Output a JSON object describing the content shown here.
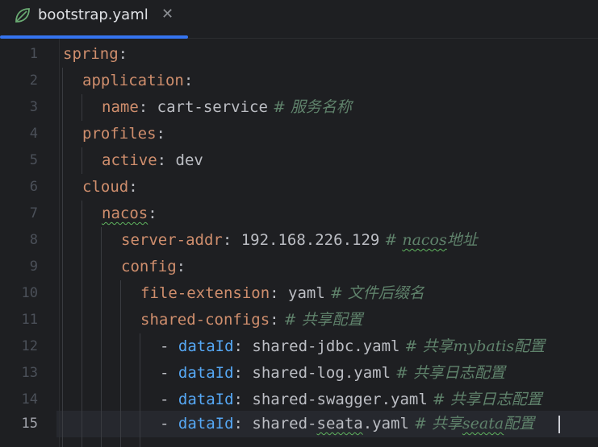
{
  "tab": {
    "filename": "bootstrap.yaml",
    "close_glyph": "✕",
    "icon": "spring-leaf-icon"
  },
  "colors": {
    "background": "#1e1f22",
    "key": "#cf8e6d",
    "blue_key": "#56a8f5",
    "comment": "#5f826b",
    "text": "#bcbec4",
    "accent": "#3574f0"
  },
  "lines": [
    {
      "num": "1",
      "key": "spring",
      "colon": ":",
      "value": "",
      "comment": ""
    },
    {
      "num": "2",
      "key": "application",
      "colon": ":",
      "value": "",
      "comment": ""
    },
    {
      "num": "3",
      "key": "name",
      "colon": ":",
      "value": " cart-service",
      "comment": " # 服务名称"
    },
    {
      "num": "4",
      "key": "profiles",
      "colon": ":",
      "value": "",
      "comment": ""
    },
    {
      "num": "5",
      "key": "active",
      "colon": ":",
      "value": " dev",
      "comment": ""
    },
    {
      "num": "6",
      "key": "cloud",
      "colon": ":",
      "value": "",
      "comment": ""
    },
    {
      "num": "7",
      "key": "nacos",
      "colon": ":",
      "value": "",
      "comment": ""
    },
    {
      "num": "8",
      "key": "server-addr",
      "colon": ":",
      "value": " 192.168.226.129",
      "comment_hash": " # ",
      "comment_word": "nacos",
      "comment_tail": "地址"
    },
    {
      "num": "9",
      "key": "config",
      "colon": ":",
      "value": "",
      "comment": ""
    },
    {
      "num": "10",
      "key": "file-extension",
      "colon": ":",
      "value": " yaml",
      "comment": " # 文件后缀名"
    },
    {
      "num": "11",
      "key": "shared-configs",
      "colon": ":",
      "value": "",
      "comment": " # 共享配置"
    },
    {
      "num": "12",
      "dash": "- ",
      "key": "dataId",
      "colon": ":",
      "value": " shared-jdbc.yaml",
      "comment": " # 共享mybatis配置"
    },
    {
      "num": "13",
      "dash": "- ",
      "key": "dataId",
      "colon": ":",
      "value": " shared-log.yaml",
      "comment": " # 共享日志配置"
    },
    {
      "num": "14",
      "dash": "- ",
      "key": "dataId",
      "colon": ":",
      "value": " shared-swagger.yaml",
      "comment": " # 共享日志配置"
    },
    {
      "num": "15",
      "dash": "- ",
      "key": "dataId",
      "colon": ":",
      "value_pre": " shared-",
      "value_squig": "seata",
      "value_post": ".yaml",
      "comment_hash": " # 共享",
      "comment_word": "seata",
      "comment_tail": "配置"
    }
  ]
}
